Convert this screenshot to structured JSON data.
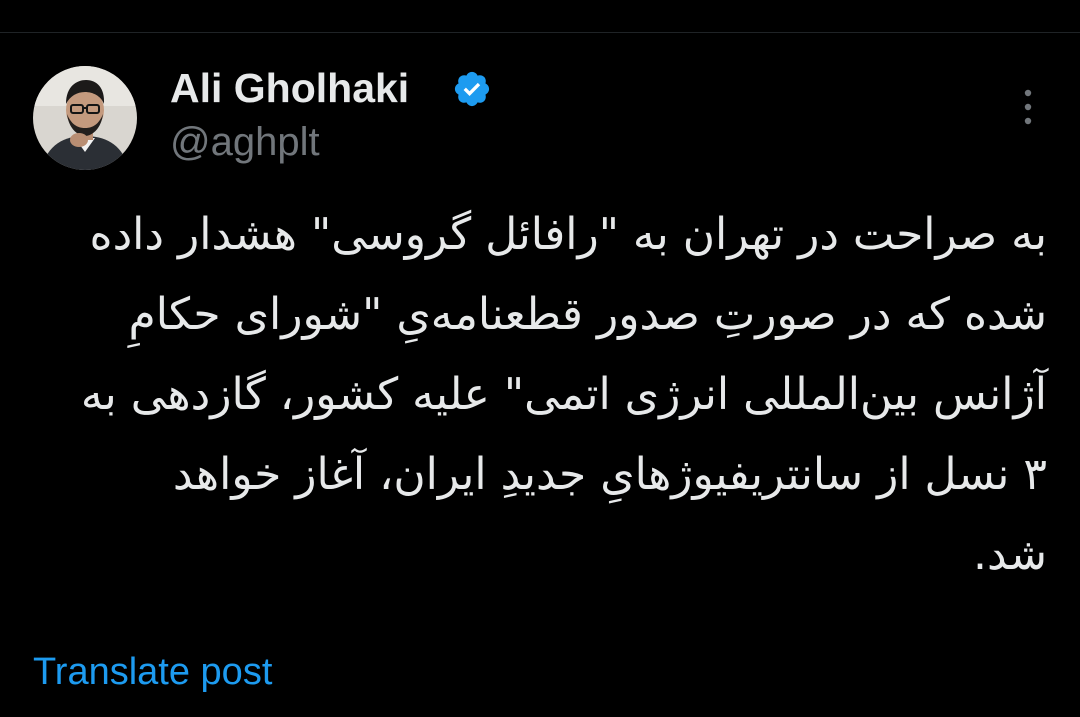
{
  "post": {
    "author": {
      "display_name": "Ali Gholhaki",
      "handle": "@aghplt",
      "verified": true,
      "avatar_icon": "profile-photo"
    },
    "more_icon": "more-vertical-icon",
    "text": "به صراحت در تهران به \"رافائل گروسی\" هشدار داده\nشده که در صورتِ صدور قطعنامه‌یِ \"شورای حکامِ\nآژانس بین‌المللی انرژی اتمی\" علیه کشور، گازدهی به\n۳ نسل از سانتریفیوژهایِ جدیدِ ایران، آغاز خواهد\nشد.",
    "translate_label": "Translate post"
  },
  "colors": {
    "background": "#000000",
    "text_primary": "#e7e9ea",
    "text_secondary": "#71767b",
    "accent": "#1d9bf0",
    "verified_badge": "#1d9bf0"
  }
}
